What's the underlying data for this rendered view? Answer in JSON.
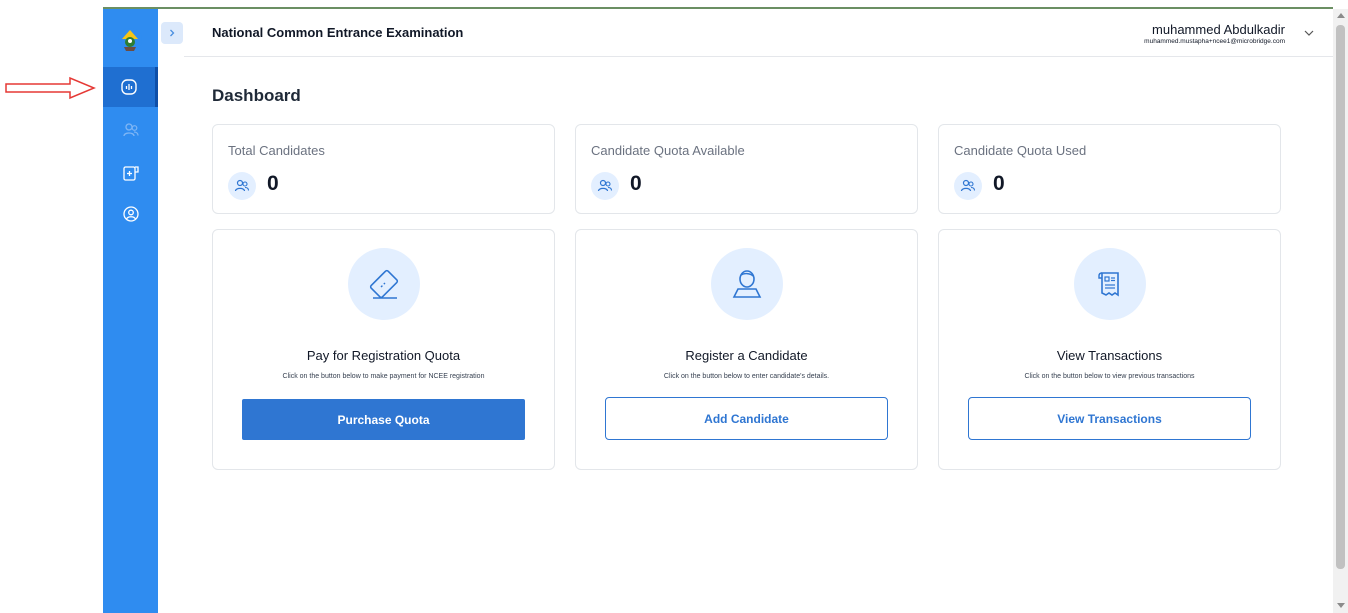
{
  "header": {
    "app_title": "National Common Entrance Examination",
    "user_name": "muhammed Abdulkadir",
    "user_email": "muhammed.mustapha+ncee1@microbridge.com"
  },
  "sidebar": {
    "items": [
      {
        "icon": "dashboard-icon",
        "active": true
      },
      {
        "icon": "users-icon",
        "active": false
      },
      {
        "icon": "payment-icon",
        "active": false
      },
      {
        "icon": "profile-icon",
        "active": false
      }
    ]
  },
  "page": {
    "title": "Dashboard"
  },
  "stats": [
    {
      "label": "Total Candidates",
      "value": "0",
      "icon": "users-icon"
    },
    {
      "label": "Candidate Quota Available",
      "value": "0",
      "icon": "users-icon"
    },
    {
      "label": "Candidate Quota Used",
      "value": "0",
      "icon": "users-icon"
    }
  ],
  "actions": [
    {
      "title": "Pay for Registration Quota",
      "description": "Click on the button below to make payment for NCEE registration",
      "button": "Purchase Quota",
      "icon": "card-icon"
    },
    {
      "title": "Register a Candidate",
      "description": "Click on the button below to enter candidate's details.",
      "button": "Add Candidate",
      "icon": "candidate-icon"
    },
    {
      "title": "View Transactions",
      "description": "Click on the button below to view previous transactions",
      "button": "View Transactions",
      "icon": "receipt-icon"
    }
  ],
  "colors": {
    "sidebar": "#2f8cf0",
    "primary": "#2f76d2",
    "icon_bg": "#e3efff",
    "annotation_arrow": "#e53935"
  }
}
